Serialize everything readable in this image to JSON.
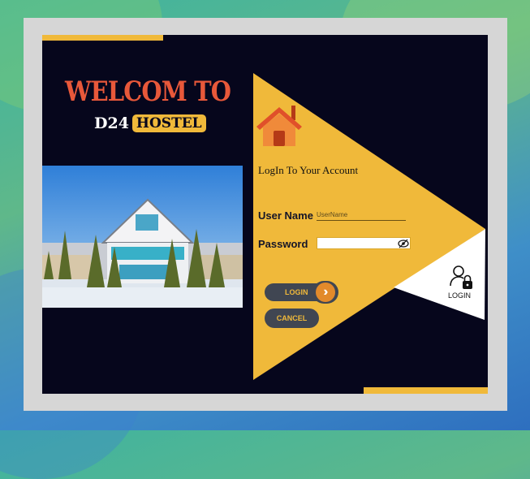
{
  "header": {
    "welcome": "WELCOM TO",
    "brand_prefix": "D24",
    "brand_badge": "HOSTEL"
  },
  "form": {
    "title": "LogIn To  Your Account",
    "username_label": "User Name",
    "username_placeholder": "UserName",
    "password_label": "Password",
    "login_button": "LOGIN",
    "cancel_button": "CANCEL"
  },
  "side_badge": {
    "caption": "LOGIN",
    "icon": "user-lock-icon"
  },
  "icons": {
    "house": "house-icon",
    "eye": "eye-slash-icon",
    "chevron": "double-chevron-right-icon"
  },
  "colors": {
    "accent": "#f0b93a",
    "panel": "#06061c",
    "welcome": "#e8583a",
    "button": "#404652",
    "chevron": "#e28a2b"
  }
}
